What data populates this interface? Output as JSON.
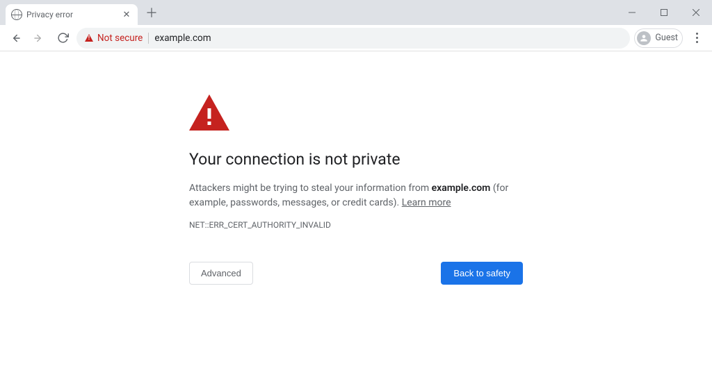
{
  "tab": {
    "title": "Privacy error"
  },
  "toolbar": {
    "security_label": "Not secure",
    "url": "example.com",
    "profile_label": "Guest"
  },
  "interstitial": {
    "heading": "Your connection is not private",
    "body_prefix": "Attackers might be trying to steal your information from ",
    "body_host": "example.com",
    "body_suffix": " (for example, passwords, messages, or credit cards). ",
    "learn_more": "Learn more",
    "error_code": "NET::ERR_CERT_AUTHORITY_INVALID",
    "advanced_label": "Advanced",
    "back_label": "Back to safety"
  },
  "colors": {
    "danger": "#c5221f",
    "primary": "#1a73e8"
  }
}
